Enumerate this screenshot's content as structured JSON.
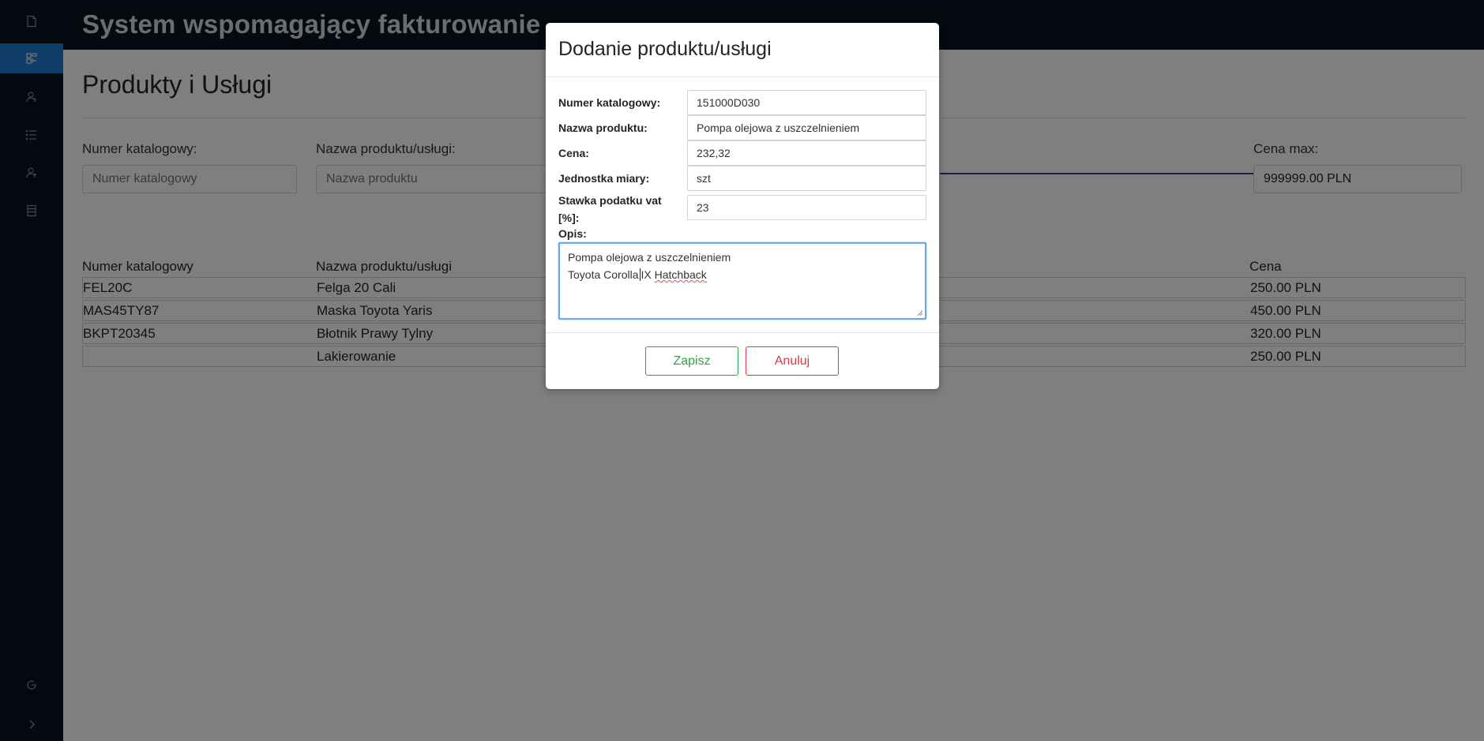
{
  "app": {
    "title": "System wspomagający fakturowanie"
  },
  "sidebar": {
    "items": [
      {
        "name": "document-icon"
      },
      {
        "name": "products-icon",
        "active": true
      },
      {
        "name": "clients-icon"
      },
      {
        "name": "list-icon"
      },
      {
        "name": "users-icon"
      },
      {
        "name": "database-icon"
      }
    ],
    "bottom": [
      {
        "name": "logout-icon"
      },
      {
        "name": "expand-icon"
      }
    ]
  },
  "page": {
    "title": "Produkty i Usługi",
    "filters": {
      "catalog_label": "Numer katalogowy:",
      "catalog_placeholder": "Numer katalogowy",
      "name_label": "Nazwa produktu/usługi:",
      "name_placeholder": "Nazwa produktu",
      "price_max_label": "Cena max:",
      "price_max_value": "999999.00 PLN"
    },
    "table": {
      "headers": {
        "catalog": "Numer katalogowy",
        "name": "Nazwa produktu/usługi",
        "price": "Cena"
      },
      "rows": [
        {
          "catalog": "FEL20C",
          "name": "Felga 20 Cali",
          "price": "250.00 PLN"
        },
        {
          "catalog": "MAS45TY87",
          "name": "Maska Toyota Yaris",
          "price": "450.00 PLN"
        },
        {
          "catalog": "BKPT20345",
          "name": "Błotnik Prawy Tylny",
          "price": "320.00 PLN"
        },
        {
          "catalog": "",
          "name": "Lakierowanie",
          "price": "250.00 PLN"
        }
      ]
    }
  },
  "modal": {
    "title": "Dodanie produktu/usługi",
    "fields": {
      "catalog_label": "Numer katalogowy:",
      "catalog_value": "151000D030",
      "name_label": "Nazwa produktu:",
      "name_value": "Pompa olejowa z uszczelnieniem",
      "price_label": "Cena:",
      "price_value": "232,32",
      "unit_label": "Jednostka miary:",
      "unit_value": "szt",
      "vat_label": "Stawka podatku vat [%]:",
      "vat_value": "23",
      "desc_label": "Opis:",
      "desc_line1": "Pompa olejowa z uszczelnieniem",
      "desc_line2_a": "Toyota Corolla",
      "desc_line2_b": "IX",
      "desc_line2_c": "Hatchback"
    },
    "buttons": {
      "save": "Zapisz",
      "cancel": "Anuluj"
    }
  },
  "colors": {
    "sidebar_bg": "#0b1423",
    "active_nav": "#1f78d1",
    "save": "#28a745",
    "cancel": "#dc3545",
    "slider": "#2c3e91"
  }
}
